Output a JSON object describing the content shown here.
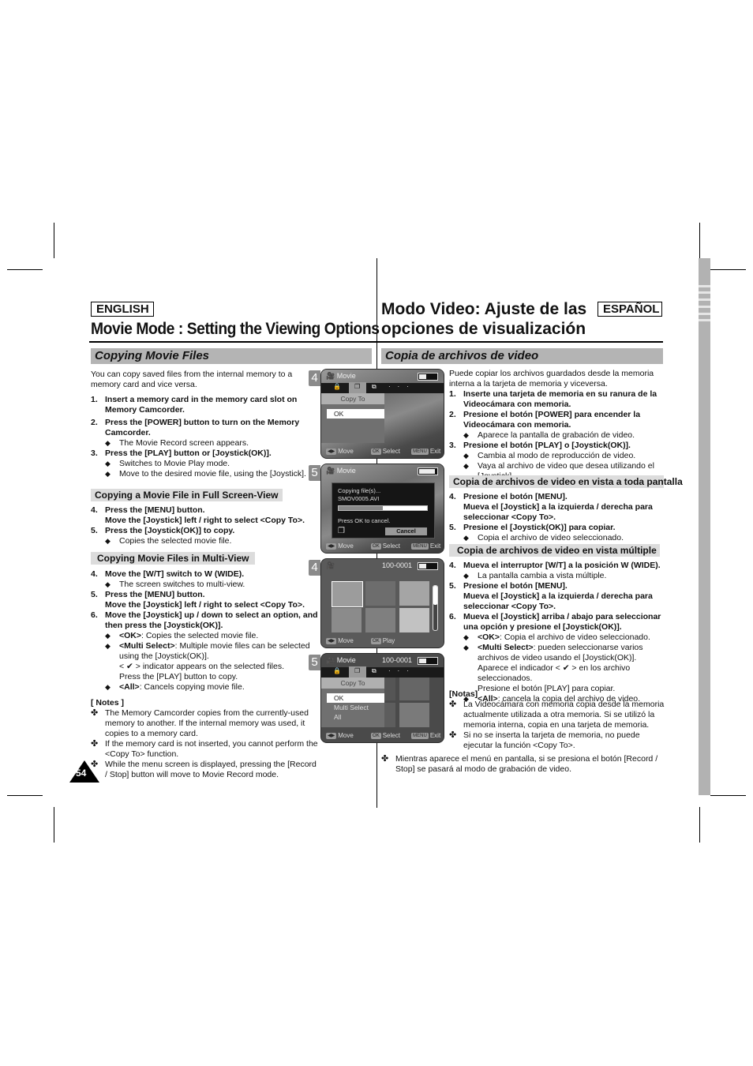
{
  "page_number": "54",
  "english": {
    "lang_label": "ENGLISH",
    "title": "Movie Mode : Setting the Viewing Options",
    "section_title": "Copying Movie Files",
    "intro": "You can copy saved files from the internal memory to a memory card and vice versa.",
    "steps_intro": [
      {
        "num": "1.",
        "text": "Insert a memory card in the memory card slot on Memory Camcorder.",
        "bullets": []
      },
      {
        "num": "2.",
        "text": "Press the [POWER] button to turn on the Memory Camcorder.",
        "bullets": [
          "The Movie Record screen appears."
        ]
      },
      {
        "num": "3.",
        "text": "Press the [PLAY] button or [Joystick(OK)].",
        "bullets": [
          "Switches to Movie Play mode.",
          "Move to the desired movie file, using the [Joystick]."
        ]
      }
    ],
    "sub1_title": "Copying a Movie File in Full Screen-View",
    "sub1_steps": [
      {
        "num": "4.",
        "text": "Press the [MENU] button.",
        "text2": "Move the [Joystick] left / right to select <Copy To>."
      },
      {
        "num": "5.",
        "text": "Press the [Joystick(OK)] to copy.",
        "bullet": "Copies the selected movie file."
      }
    ],
    "sub2_title": "Copying Movie Files in Multi-View",
    "sub2_steps": [
      {
        "num": "4.",
        "text": "Move the [W/T] switch to W (WIDE).",
        "bullet": "The screen switches to multi-view."
      },
      {
        "num": "5.",
        "text": "Press the [MENU] button.",
        "text2": "Move the [Joystick] left / right to select <Copy To>."
      },
      {
        "num": "6.",
        "text": "Move the [Joystick] up / down to select an option, and then press the [Joystick(OK)]."
      }
    ],
    "options": [
      {
        "label": "<OK>",
        "desc": ": Copies the selected movie file."
      },
      {
        "label": "<Multi Select>",
        "desc": ": Multiple movie files can be selected using the [Joystick(OK)].",
        "extra1": "< ✔ > indicator appears on the selected files.",
        "extra2": "Press the [PLAY] button to copy."
      },
      {
        "label": "<All>",
        "desc": ": Cancels copying movie file."
      }
    ],
    "notes_title": "[ Notes ]",
    "notes": [
      "The Memory Camcorder copies from the currently-used memory to another. If the internal memory was used, it copies to a memory card.",
      "If the memory card is not inserted, you cannot perform the <Copy To> function.",
      "While the menu screen is displayed, pressing the [Record / Stop] button will move to Movie Record mode."
    ]
  },
  "spanish": {
    "lang_label": "ESPAÑOL",
    "title_line1": "Modo Video:  Ajuste de las",
    "title_line2": "opciones de visualización",
    "section_title": "Copia de archivos de video",
    "intro": "Puede copiar los archivos guardados desde la memoria interna a la tarjeta de memoria y viceversa.",
    "steps_intro": [
      {
        "num": "1.",
        "text": "Inserte una tarjeta de memoria en su ranura de la Videocámara con memoria.",
        "bullets": []
      },
      {
        "num": "2.",
        "text": "Presione el botón [POWER] para encender la Videocámara con memoria.",
        "bullets": [
          "Aparece la pantalla de grabación de video."
        ]
      },
      {
        "num": "3.",
        "text": "Presione el botón [PLAY] o [Joystick(OK)].",
        "bullets": [
          "Cambia al modo de reproducción de video.",
          "Vaya al archivo de video que desea utilizando el [Joystick]."
        ]
      }
    ],
    "sub1_title": "Copia de archivos de video en vista a toda pantalla",
    "sub1_steps": [
      {
        "num": "4.",
        "text": "Presione el botón [MENU].",
        "text2": "Mueva el [Joystick] a la izquierda / derecha para seleccionar <Copy To>."
      },
      {
        "num": "5.",
        "text": "Presione el [Joystick(OK)] para copiar.",
        "bullet": "Copia el archivo de video seleccionado."
      }
    ],
    "sub2_title": "Copia de archivos de video en vista múltiple",
    "sub2_steps": [
      {
        "num": "4.",
        "text": "Mueva el interruptor [W/T] a la posición W (WIDE).",
        "bullet": "La pantalla cambia a vista múltiple."
      },
      {
        "num": "5.",
        "text": "Presione el botón [MENU].",
        "text2": "Mueva el [Joystick] a la izquierda / derecha para seleccionar <Copy To>."
      },
      {
        "num": "6.",
        "text": "Mueva el [Joystick] arriba / abajo para seleccionar una opción y presione el [Joystick(OK)]."
      }
    ],
    "options": [
      {
        "label": "<OK>",
        "desc": ": Copia el archivo de video seleccionado."
      },
      {
        "label": "<Multi Select>",
        "desc": ": pueden seleccionarse varios archivos de video usando el [Joystick(OK)].",
        "extra1": "Aparece el indicador < ✔ > en los archivo seleccionados.",
        "extra2": "Presione el botón [PLAY] para copiar."
      },
      {
        "label": "<All>",
        "desc": ": cancela la copia del archivo de video."
      }
    ],
    "notes_title": "[Notas]",
    "notes": [
      "La Videocámara con memoria copia desde la memoria actualmente utilizada a otra memoria. Si se utilizó la memoria interna, copia en una tarjeta de memoria.",
      "Si no se inserta la tarjeta de memoria, no puede ejecutar la función <Copy To>.",
      "Mientras aparece el menú en pantalla, si se presiona el botón [Record / Stop] se pasará al modo de grabación de video."
    ]
  },
  "screens": [
    {
      "step": "4",
      "mode": "Movie",
      "menu_title": "Copy To",
      "items": [
        "OK"
      ],
      "selected": 0,
      "footer": {
        "move": "Move",
        "ok_key": "OK",
        "select": "Select",
        "menu_key": "MENU",
        "exit": "Exit"
      }
    },
    {
      "step": "5",
      "mode": "Movie",
      "dialog_line1": "Copying file(s)...",
      "dialog_line2": "SMOV0005.AVI",
      "progress": 0.5,
      "dialog_hint": "Press OK to cancel.",
      "cancel_label": "Cancel",
      "footer": {
        "move": "Move",
        "ok_key": "OK",
        "select": "Select",
        "menu_key": "MENU",
        "exit": "Exit"
      }
    },
    {
      "step": "4",
      "file_no": "100-0001",
      "thumb_count": 6,
      "footer": {
        "move": "Move",
        "ok_key": "OK",
        "play": "Play"
      }
    },
    {
      "step": "5",
      "mode": "Movie",
      "file_no": "100-0001",
      "menu_title": "Copy To",
      "items": [
        "OK",
        "Multi Select",
        "All"
      ],
      "selected": 0,
      "footer": {
        "move": "Move",
        "ok_key": "OK",
        "select": "Select",
        "menu_key": "MENU",
        "exit": "Exit"
      }
    }
  ],
  "colors": {
    "section_bar": "#b4b4b4",
    "sub_bar": "#dcdcdc",
    "side_tab": "#b2b2b2"
  }
}
